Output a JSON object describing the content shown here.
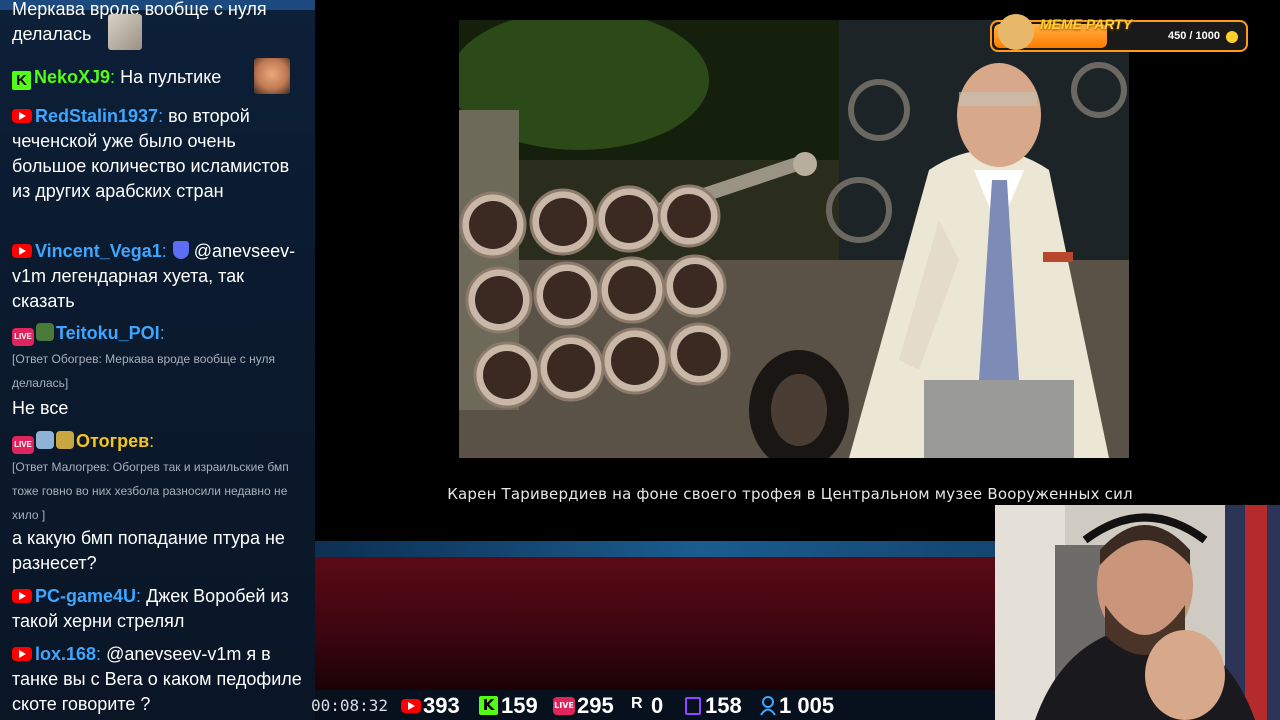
{
  "chat": {
    "top_message": {
      "text": "Меркава вроде вообще с нуля делалась"
    },
    "messages": [
      {
        "platform": "kick",
        "user": "NekoXJ9",
        "user_color": "#53fc18",
        "text": "На пультике"
      },
      {
        "platform": "youtube",
        "user": "RedStalin1937",
        "user_color": "#3ea6ff",
        "text": "во второй чеченской уже было очень большое количество исламистов из других арабских стран"
      },
      {
        "platform": "youtube",
        "user": "Vincent_Vega1",
        "user_color": "#3ea6ff",
        "text": "@anevseev-v1m легендарная хуета, так сказать"
      },
      {
        "platform": "vklive",
        "user": "Teitoku_POI",
        "user_color": "#3ea6ff",
        "reply": "[Ответ Обогрев: Меркава вроде вообще с нуля делалась]",
        "text": "Не все"
      },
      {
        "platform": "vklive",
        "user": "Отогрев",
        "user_color": "#f5c518",
        "reply": "[Ответ Малогрев: Обогрев так и израильские бмп тоже говно  во них хезбола разносили недавно не хило ]",
        "text": "а какую бмп попадание птура не разнесет?"
      },
      {
        "platform": "youtube",
        "user": "PC-game4U",
        "user_color": "#3ea6ff",
        "text": "Джек Воробей из такой херни стрелял"
      },
      {
        "platform": "youtube",
        "user": "lox.168",
        "user_color": "#3ea6ff",
        "text": "@anevseev-v1m я в танке вы с Вега о каком педофиле скоте говорите ?"
      }
    ]
  },
  "video": {
    "caption": "Карен Таривердиев на фоне своего трофея в Центральном музее Вооруженных сил"
  },
  "meme_party": {
    "title": "MEME PARTY",
    "count": "450 / 1000",
    "progress": 0.45
  },
  "stats": {
    "timer": "00:08:32",
    "youtube": "393",
    "kick": "159",
    "vklive": "295",
    "rutube": "0",
    "twitch": "158",
    "total": "1 005"
  },
  "colors": {
    "youtube": "#ff0000",
    "kick": "#53fc18",
    "vklive": "#e0245e",
    "accent": "#ff9a1f"
  }
}
